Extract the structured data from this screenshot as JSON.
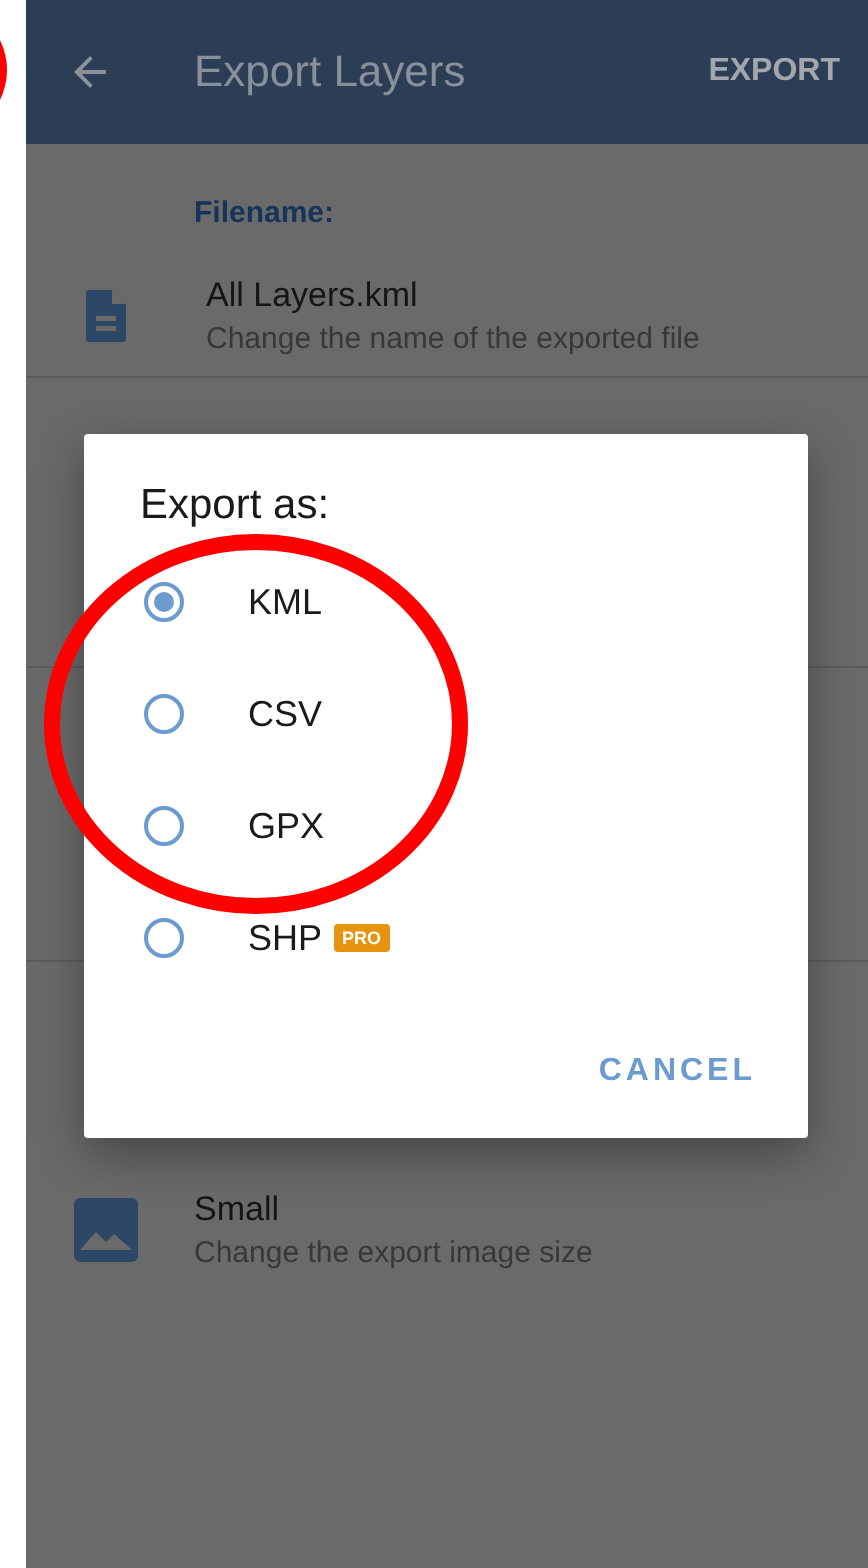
{
  "app_bar": {
    "title": "Export Layers",
    "action": "EXPORT"
  },
  "settings": [
    {
      "kind": "header",
      "text": "Filename:"
    },
    {
      "kind": "file",
      "title": "All Layers.kml",
      "subtitle": "Change the name of the exported file"
    },
    {
      "kind": "image",
      "title": "Small",
      "subtitle": "Change the export image size"
    }
  ],
  "dialog": {
    "title": "Export as:",
    "options": [
      {
        "label": "KML",
        "selected": true
      },
      {
        "label": "CSV",
        "selected": false
      },
      {
        "label": "GPX",
        "selected": false
      },
      {
        "label": "SHP",
        "selected": false,
        "badge": "PRO"
      }
    ],
    "button": "CANCEL"
  }
}
